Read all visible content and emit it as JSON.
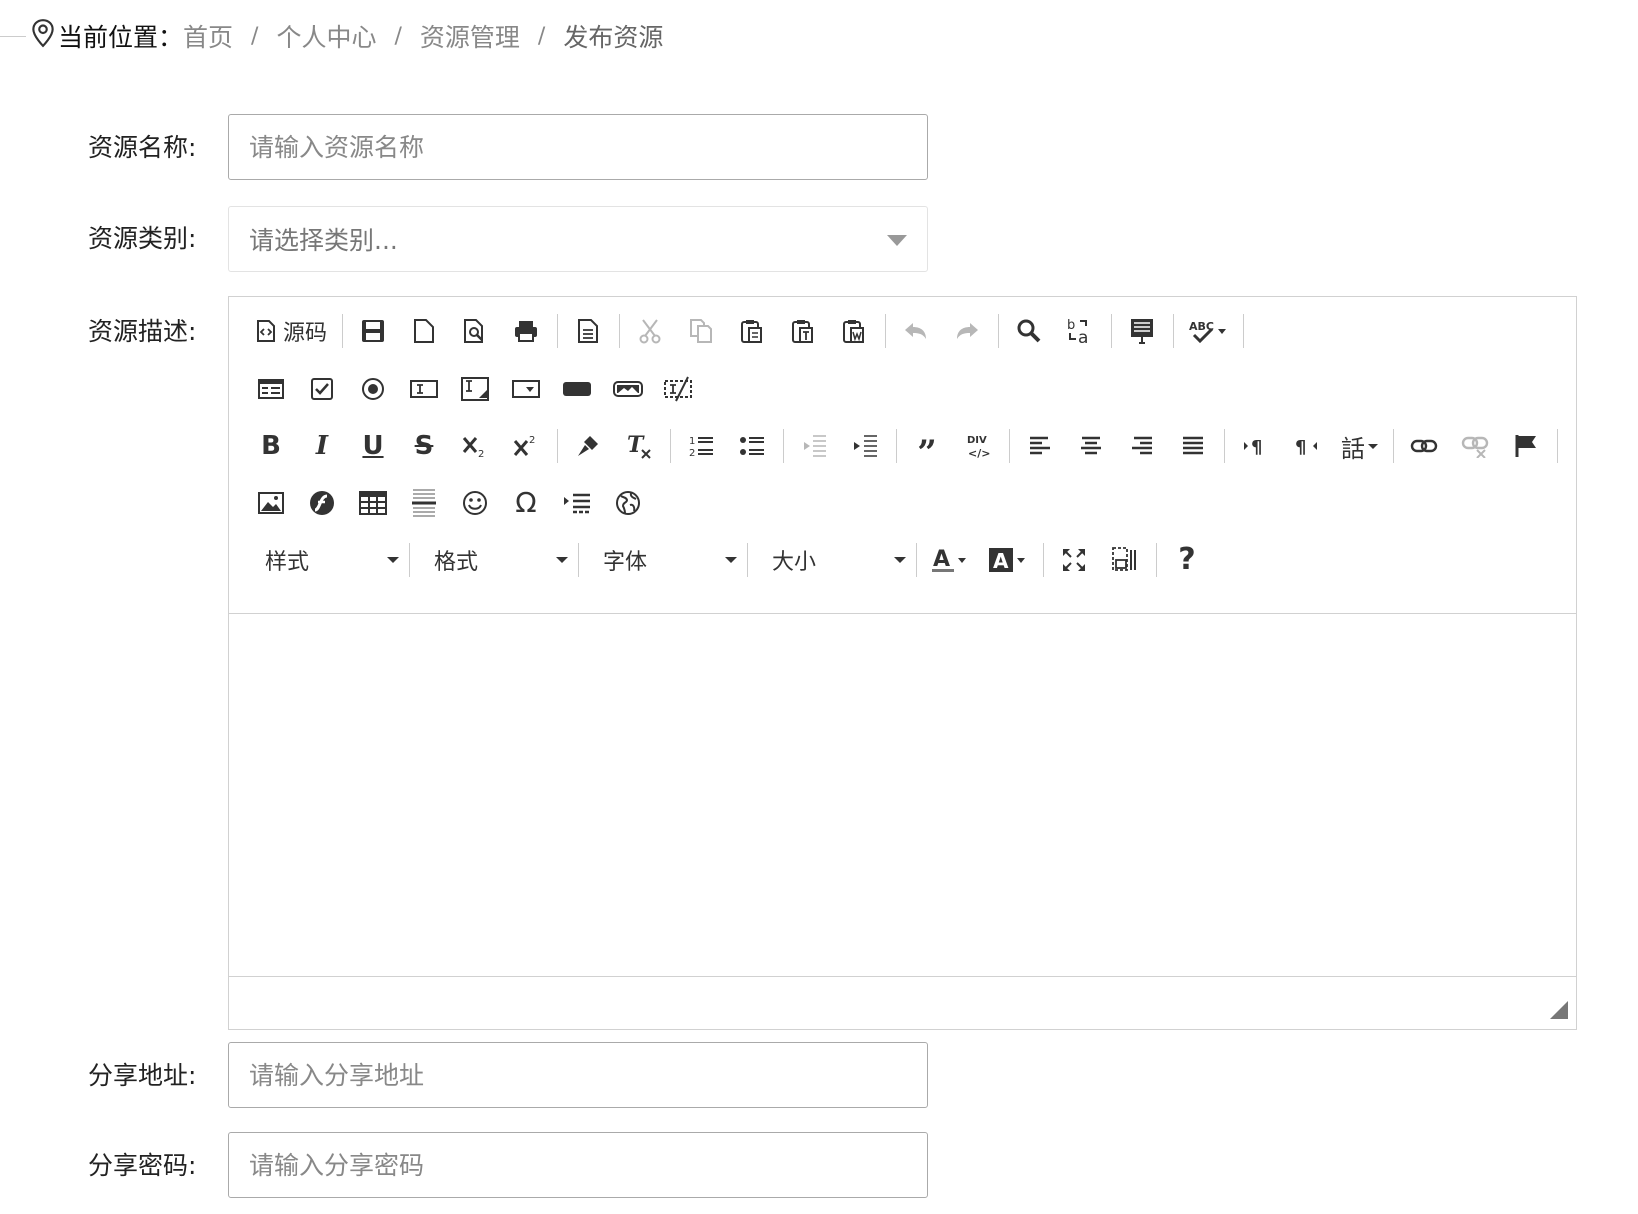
{
  "breadcrumb": {
    "label": "当前位置：",
    "items": [
      "首页",
      "个人中心",
      "资源管理",
      "发布资源"
    ],
    "separator": "/"
  },
  "form": {
    "name": {
      "label": "资源名称:",
      "placeholder": "请输入资源名称"
    },
    "category": {
      "label": "资源类别:",
      "placeholder": "请选择类别..."
    },
    "description": {
      "label": "资源描述:"
    },
    "share_url": {
      "label": "分享地址:",
      "placeholder": "请输入分享地址"
    },
    "share_password": {
      "label": "分享密码:",
      "placeholder": "请输入分享密码"
    }
  },
  "editor": {
    "source_label": "源码",
    "language_label": "話",
    "abc_label": "ABC",
    "combos": {
      "styles": "样式",
      "format": "格式",
      "font": "字体",
      "size": "大小"
    },
    "help_label": "?"
  }
}
